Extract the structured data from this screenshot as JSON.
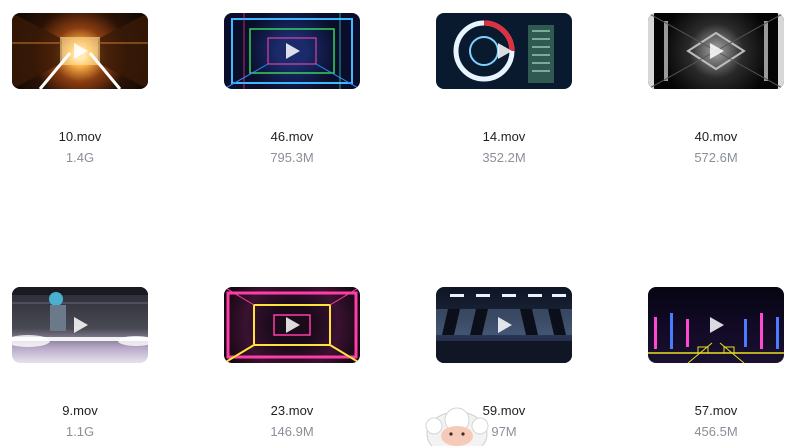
{
  "files": [
    {
      "name": "10.mov",
      "size": "1.4G"
    },
    {
      "name": "46.mov",
      "size": "795.3M"
    },
    {
      "name": "14.mov",
      "size": "352.2M"
    },
    {
      "name": "40.mov",
      "size": "572.6M"
    },
    {
      "name": "9.mov",
      "size": "1.1G"
    },
    {
      "name": "23.mov",
      "size": "146.9M"
    },
    {
      "name": "59.mov",
      "size": "97M"
    },
    {
      "name": "57.mov",
      "size": "456.5M"
    }
  ],
  "icons": {
    "play": "play-icon",
    "mascot": "mascot-avatar-icon"
  }
}
